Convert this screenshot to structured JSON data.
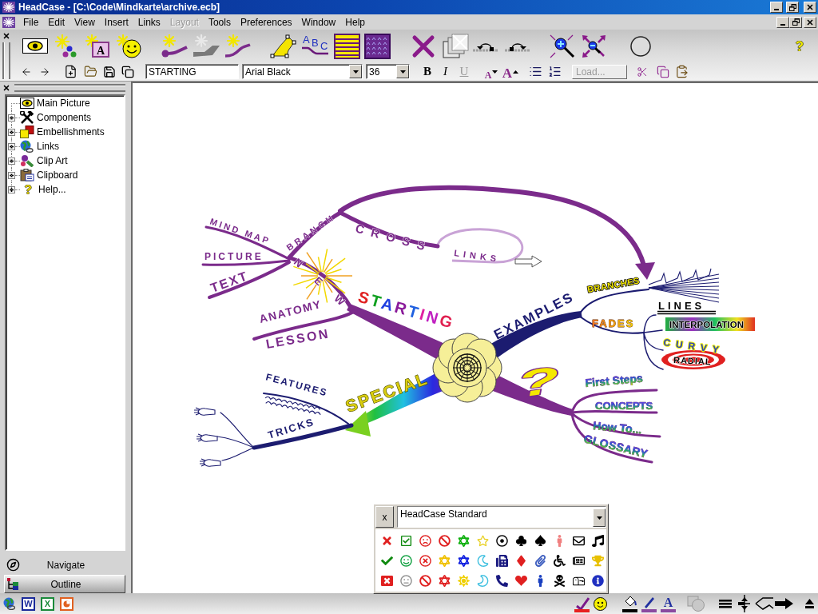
{
  "window": {
    "title": "HeadCase - [C:\\Code\\Mindkarte\\archive.ecb]"
  },
  "menu": [
    {
      "label": "File",
      "disabled": false
    },
    {
      "label": "Edit",
      "disabled": false
    },
    {
      "label": "View",
      "disabled": false
    },
    {
      "label": "Insert",
      "disabled": false
    },
    {
      "label": "Links",
      "disabled": false
    },
    {
      "label": "Layout",
      "disabled": true
    },
    {
      "label": "Tools",
      "disabled": false
    },
    {
      "label": "Preferences",
      "disabled": false
    },
    {
      "label": "Window",
      "disabled": false
    },
    {
      "label": "Help",
      "disabled": false
    }
  ],
  "toolbar": {
    "text_box_letter": "A",
    "branch_text_letters": "ABC"
  },
  "format_bar": {
    "node_text": "STARTING",
    "font": "Arial Black",
    "font_size": "36",
    "style_buttons": [
      {
        "label": "B",
        "kind": "bold",
        "disabled": false
      },
      {
        "label": "I",
        "kind": "italic",
        "disabled": false
      },
      {
        "label": "U",
        "kind": "underline",
        "disabled": true
      }
    ],
    "size_buttons": [
      {
        "label": "A",
        "kind": "smaller"
      },
      {
        "label": "A",
        "kind": "larger"
      }
    ],
    "load_button": {
      "label": "Load...",
      "disabled": true
    }
  },
  "outline_panel": {
    "tree": [
      {
        "label": "Main Picture",
        "kind": "leaf"
      },
      {
        "label": "Components",
        "kind": "folder",
        "expanded": false
      },
      {
        "label": "Embellishments",
        "kind": "folder",
        "expanded": false
      },
      {
        "label": "Links",
        "kind": "folder",
        "expanded": false
      },
      {
        "label": "Clip Art",
        "kind": "folder",
        "expanded": false
      },
      {
        "label": "Clipboard",
        "kind": "folder",
        "expanded": false
      },
      {
        "label": "Help...",
        "kind": "folder",
        "expanded": false
      }
    ],
    "tabs": [
      {
        "label": "Navigate",
        "selected": false
      },
      {
        "label": "Outline",
        "selected": true
      }
    ]
  },
  "mind_map": {
    "branches": [
      {
        "label": "STARTING",
        "children": [
          {
            "label": "ANATOMY",
            "label_2": "LESSON"
          },
          {
            "label": "NEW",
            "children": [
              {
                "label": "MIND MAP",
                "label_2": "BRANCH",
                "children": [
                  {
                    "label": "CROSS",
                    "label_2": "LINKS"
                  }
                ]
              },
              {
                "label": "PICTURE"
              },
              {
                "label": "TEXT"
              }
            ]
          }
        ]
      },
      {
        "label": "EXAMPLES",
        "children": [
          {
            "label": "BRANCHES"
          },
          {
            "label": "FADES",
            "children": [
              {
                "label": "LINES"
              },
              {
                "label": "INTERPOLATION"
              },
              {
                "label": "CURVY"
              },
              {
                "label": "RADIAL"
              }
            ]
          }
        ]
      },
      {
        "label": "?",
        "children": [
          {
            "label": "First Steps"
          },
          {
            "label": "CONCEPTS"
          },
          {
            "label": "How To..."
          },
          {
            "label": "GLOSSARY"
          }
        ]
      },
      {
        "label": "SPECIAL",
        "children": [
          {
            "label": "FEATURES"
          },
          {
            "label": "TRICKS"
          }
        ]
      }
    ]
  },
  "symbol_palette": {
    "close": "x",
    "symbol_set": "HeadCase Standard"
  },
  "status_bar": {
    "app_shortcut_letters": [
      "W",
      "X"
    ],
    "text_color_letter": "A"
  }
}
